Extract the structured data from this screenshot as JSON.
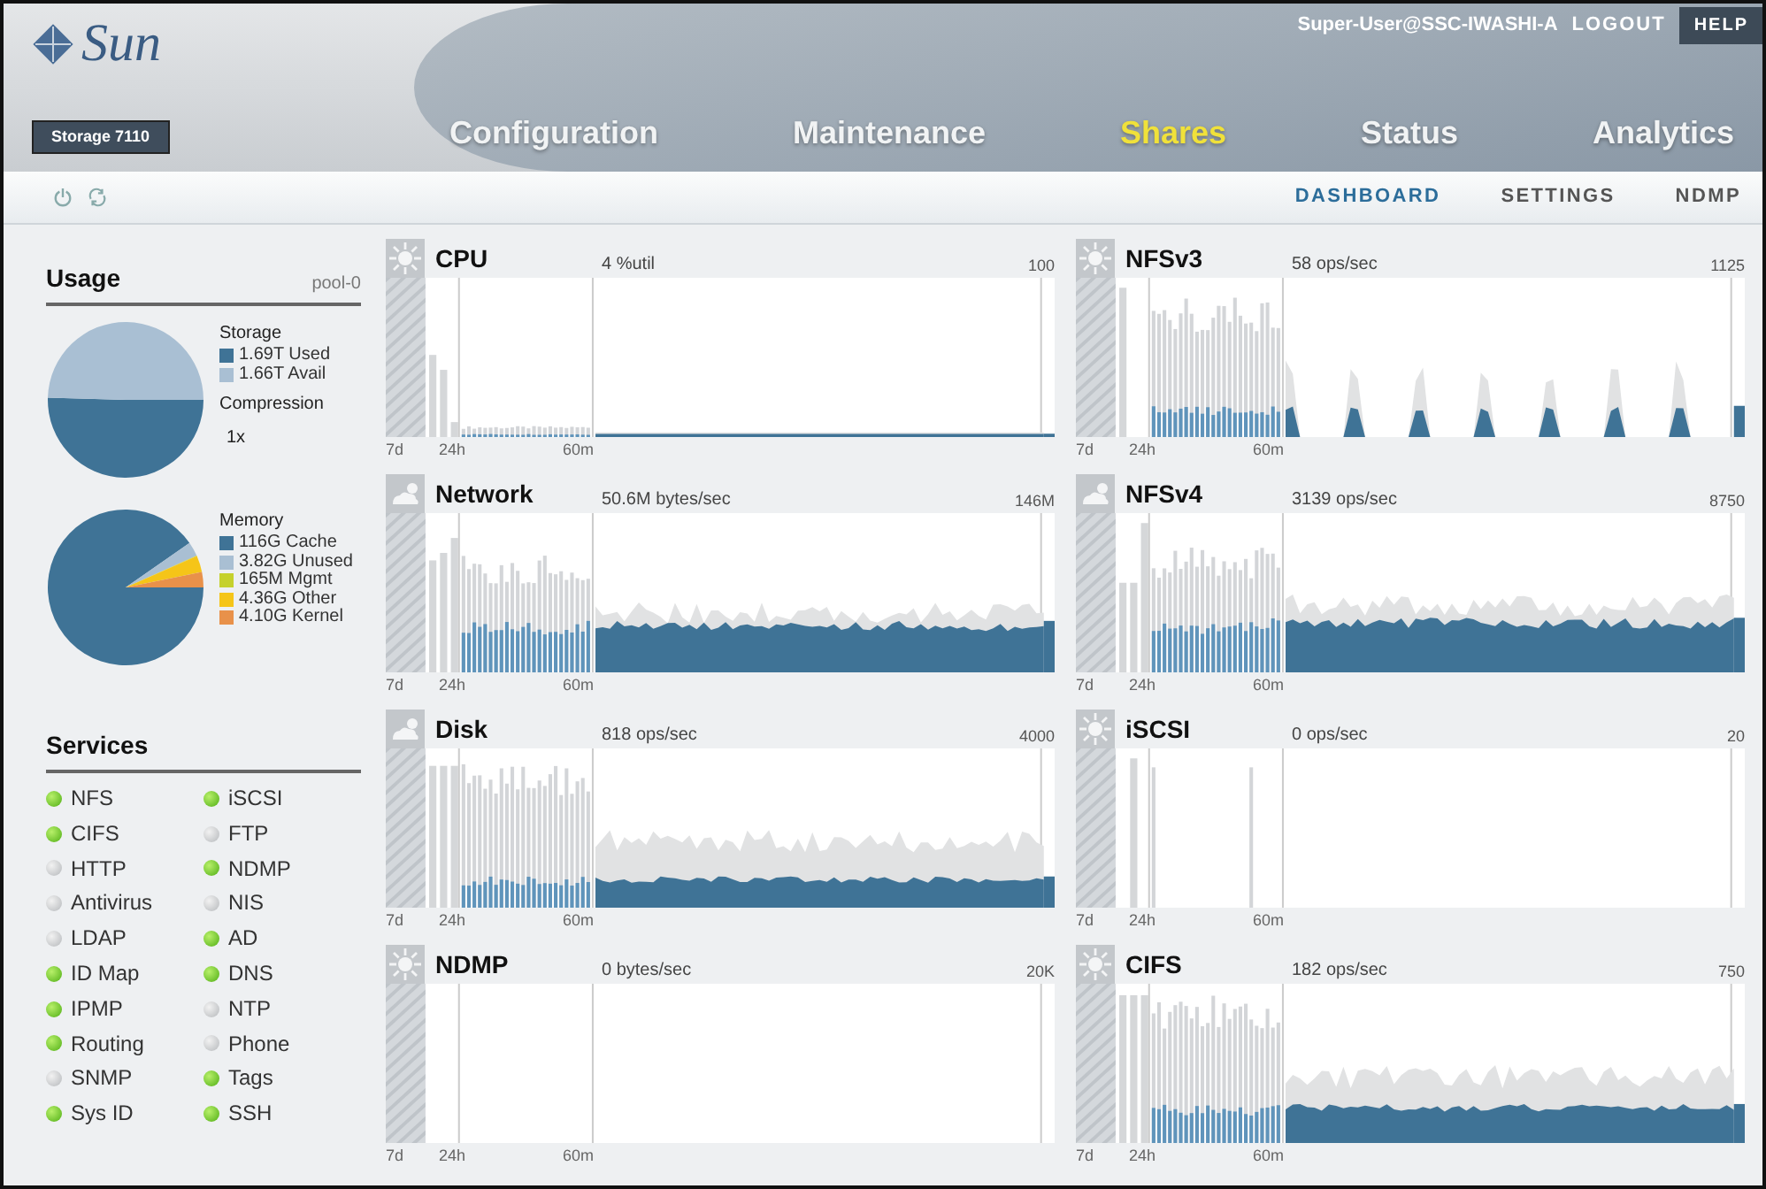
{
  "header": {
    "logo": "Sun",
    "product": "Storage 7110",
    "user": "Super-User@SSC-IWASHI-A",
    "logout": "LOGOUT",
    "help": "HELP"
  },
  "tabs": [
    {
      "label": "Configuration",
      "selected": false
    },
    {
      "label": "Maintenance",
      "selected": false
    },
    {
      "label": "Shares",
      "selected": true
    },
    {
      "label": "Status",
      "selected": false
    },
    {
      "label": "Analytics",
      "selected": false
    }
  ],
  "subtabs": [
    {
      "label": "DASHBOARD",
      "selected": true
    },
    {
      "label": "SETTINGS",
      "selected": false
    },
    {
      "label": "NDMP",
      "selected": false
    }
  ],
  "usage": {
    "title": "Usage",
    "pool": "pool-0",
    "storage": {
      "chart_data": {
        "type": "pie",
        "title": "Storage",
        "categories": [
          "1.69T Used",
          "1.66T Avail"
        ],
        "values": [
          1.69,
          1.66
        ],
        "colors": [
          "#3f7396",
          "#a9bfd3"
        ]
      },
      "compression_label": "Compression",
      "compression": "1x"
    },
    "memory": {
      "chart_data": {
        "type": "pie",
        "title": "Memory",
        "categories": [
          "116G Cache",
          "3.82G Unused",
          "165M Mgmt",
          "4.36G Other",
          "4.10G Kernel"
        ],
        "values": [
          116,
          3.82,
          0.165,
          4.36,
          4.1
        ],
        "colors": [
          "#3f7396",
          "#a9bfd3",
          "#c5d12c",
          "#f5c518",
          "#e8914a"
        ]
      }
    }
  },
  "services": {
    "title": "Services",
    "items": [
      {
        "name": "NFS",
        "on": true
      },
      {
        "name": "iSCSI",
        "on": true
      },
      {
        "name": "CIFS",
        "on": true
      },
      {
        "name": "FTP",
        "on": false
      },
      {
        "name": "HTTP",
        "on": false
      },
      {
        "name": "NDMP",
        "on": true
      },
      {
        "name": "Antivirus",
        "on": false
      },
      {
        "name": "NIS",
        "on": false
      },
      {
        "name": "LDAP",
        "on": false
      },
      {
        "name": "AD",
        "on": true
      },
      {
        "name": "ID Map",
        "on": true
      },
      {
        "name": "DNS",
        "on": true
      },
      {
        "name": "IPMP",
        "on": true
      },
      {
        "name": "NTP",
        "on": false
      },
      {
        "name": "Routing",
        "on": true
      },
      {
        "name": "Phone",
        "on": false
      },
      {
        "name": "SNMP",
        "on": false
      },
      {
        "name": "Tags",
        "on": true
      },
      {
        "name": "Sys ID",
        "on": true
      },
      {
        "name": "SSH",
        "on": true
      }
    ]
  },
  "panels": [
    {
      "title": "CPU",
      "kind": "sunny",
      "reading": "4 %util",
      "max": "100",
      "ranges": [
        "7d",
        "24h",
        "60m"
      ]
    },
    {
      "title": "NFSv3",
      "kind": "sunny",
      "reading": "58 ops/sec",
      "max": "1125",
      "ranges": [
        "7d",
        "24h",
        "60m"
      ]
    },
    {
      "title": "Network",
      "kind": "cloudy",
      "reading": "50.6M bytes/sec",
      "max": "146M",
      "ranges": [
        "7d",
        "24h",
        "60m"
      ]
    },
    {
      "title": "NFSv4",
      "kind": "cloudy",
      "reading": "3139 ops/sec",
      "max": "8750",
      "ranges": [
        "7d",
        "24h",
        "60m"
      ]
    },
    {
      "title": "Disk",
      "kind": "cloudy",
      "reading": "818 ops/sec",
      "max": "4000",
      "ranges": [
        "7d",
        "24h",
        "60m"
      ]
    },
    {
      "title": "iSCSI",
      "kind": "sunny",
      "reading": "0 ops/sec",
      "max": "20",
      "ranges": [
        "7d",
        "24h",
        "60m"
      ]
    },
    {
      "title": "NDMP",
      "kind": "sunny",
      "reading": "0 bytes/sec",
      "max": "20K",
      "ranges": [
        "7d",
        "24h",
        "60m"
      ]
    },
    {
      "title": "CIFS",
      "kind": "sunny",
      "reading": "182 ops/sec",
      "max": "750",
      "ranges": [
        "7d",
        "24h",
        "60m"
      ]
    }
  ]
}
